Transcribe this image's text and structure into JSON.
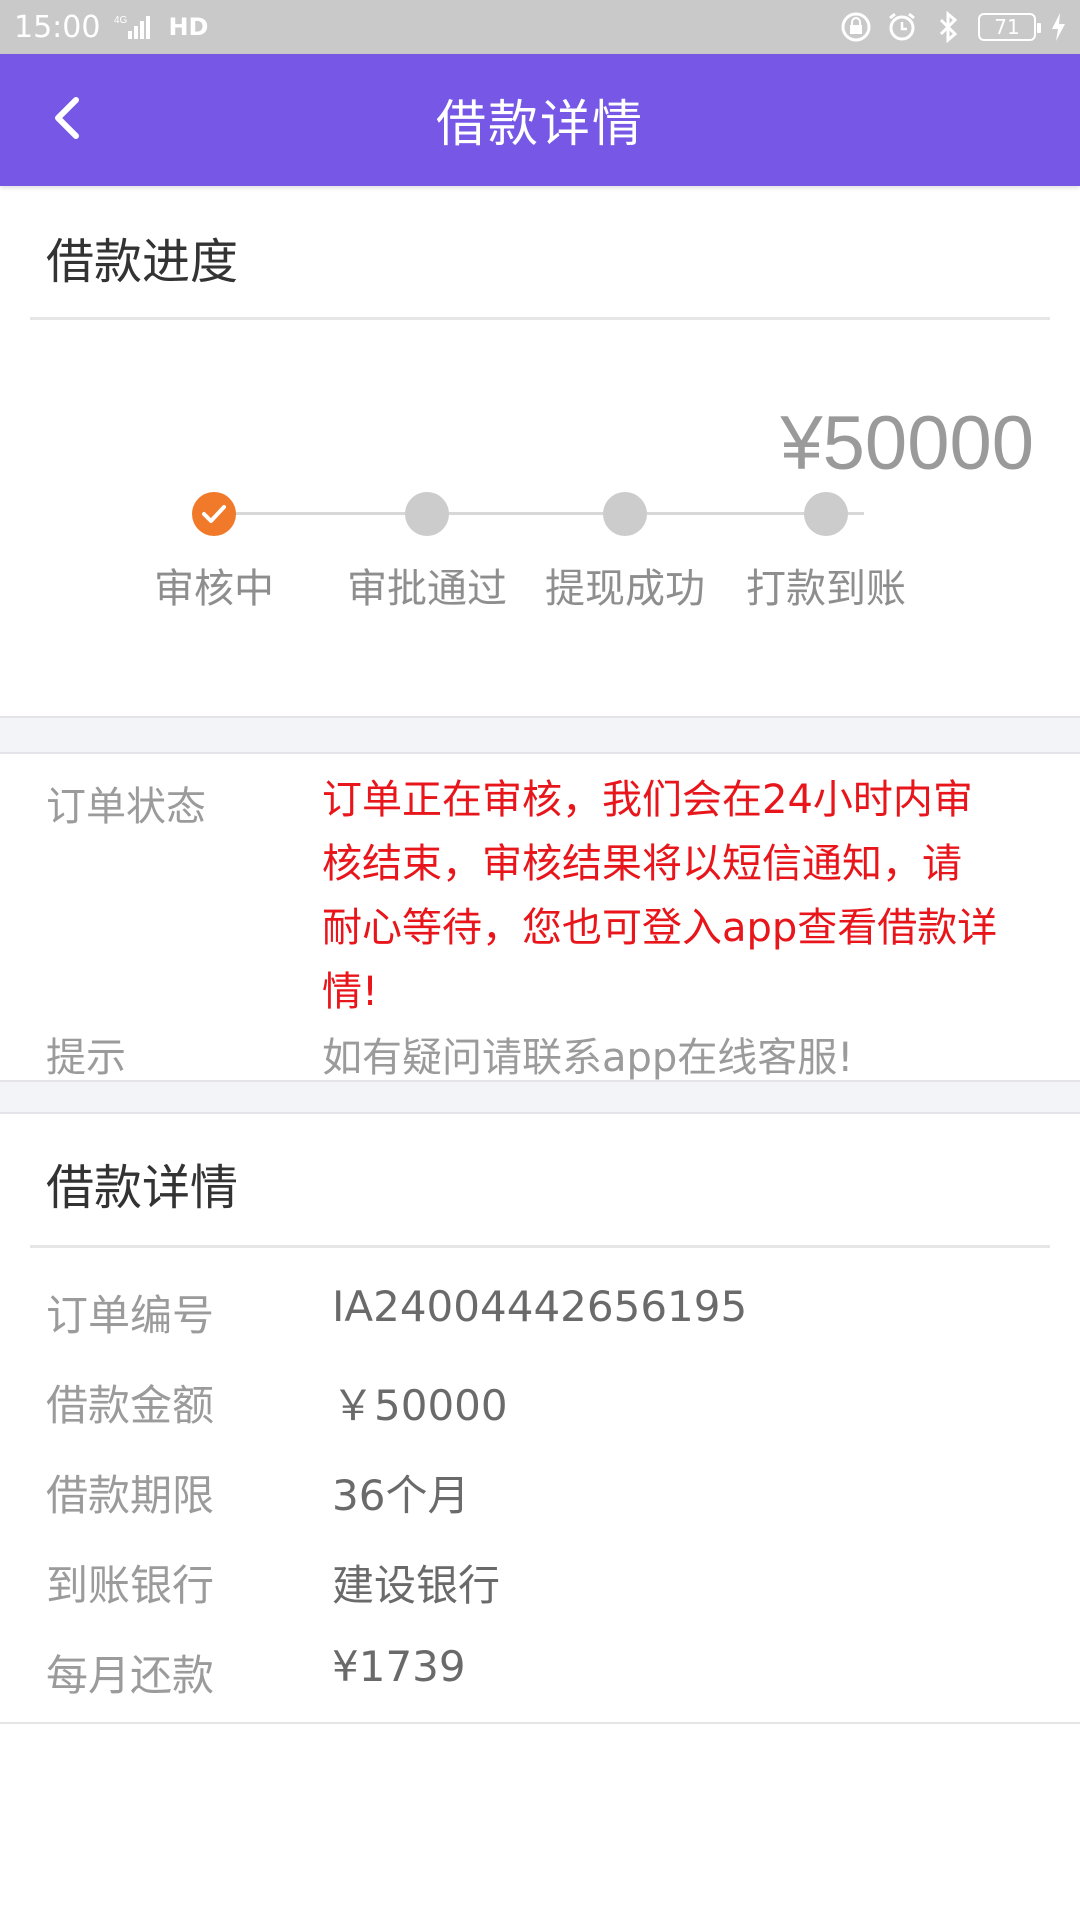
{
  "status_bar": {
    "time": "15:00",
    "network": "4G",
    "hd": "HD",
    "battery": "71"
  },
  "app_bar": {
    "title": "借款详情"
  },
  "progress": {
    "section_title": "借款进度",
    "amount": "¥50000",
    "current_step": 1,
    "steps": [
      {
        "label": "审核中",
        "done": true
      },
      {
        "label": "审批通过",
        "done": false
      },
      {
        "label": "提现成功",
        "done": false
      },
      {
        "label": "打款到账",
        "done": false
      }
    ]
  },
  "order_info": {
    "status_label": "订单状态",
    "status_lines": [
      "订单正在审核，我们会在24小时内审",
      "核结束，审核结果将以短信通知，请",
      "耐心等待，您也可登入app查看借款详",
      "情!"
    ],
    "tip_label": "提示",
    "tip_value": "如有疑问请联系app在线客服!"
  },
  "loan_details": {
    "section_title": "借款详情",
    "rows": [
      {
        "label": "订单编号",
        "value": "IA24004442656195"
      },
      {
        "label": "借款金额",
        "value": "￥50000"
      },
      {
        "label": "借款期限",
        "value": "36个月"
      },
      {
        "label": "到账银行",
        "value": "建设银行"
      },
      {
        "label": "每月还款",
        "value": "¥1739"
      }
    ]
  },
  "colors": {
    "accent": "#7657e6",
    "step_done": "#f07a2a",
    "status_text": "#e8151b"
  }
}
